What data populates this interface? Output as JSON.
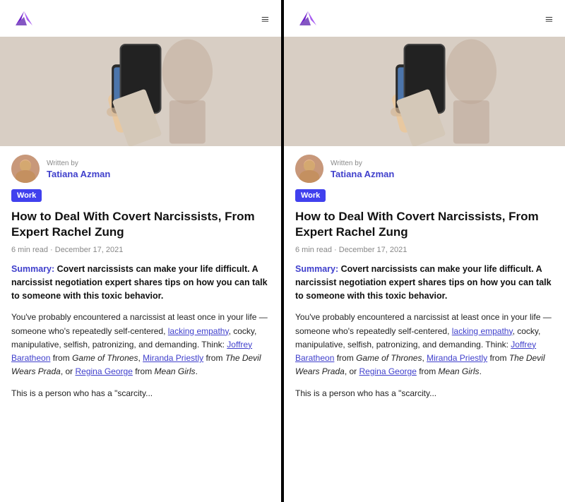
{
  "panels": [
    {
      "id": "left",
      "nav": {
        "logo_alt": "Logo",
        "menu_label": "≡"
      },
      "author": {
        "written_by": "Written by",
        "name": "Tatiana Azman"
      },
      "tag": "Work",
      "title": "How to Deal With Covert Narcissists, From Expert Rachel Zung",
      "meta": "6 min read  ·  December 17, 2021",
      "summary_label": "Summary:",
      "summary_text": " Covert narcissists can make your life difficult. A narcissist negotiation expert shares tips on how you can talk to someone with this toxic behavior.",
      "body1": "You've probably encountered a narcissist at least once in your life — someone who's repeatedly self-centered, ",
      "link1": "lacking empathy",
      "body2": ", cocky, manipulative, selfish, patronizing, and demanding. Think: ",
      "link2": "Joffrey Baratheon",
      "body3": " from ",
      "italic1": "Game of Thrones",
      "body4": ", ",
      "link3": "Miranda Priestly",
      "body5": " from ",
      "italic2": "The Devil Wears Prada",
      "body6": ", or ",
      "link4": "Regina George",
      "body7": " from ",
      "italic3": "Mean Girls",
      "body8": ".",
      "teaser": "This is a person who has a \"scarcity..."
    },
    {
      "id": "right",
      "nav": {
        "logo_alt": "Logo",
        "menu_label": "≡"
      },
      "author": {
        "written_by": "Written by",
        "name": "Tatiana Azman"
      },
      "tag": "Work",
      "title": "How to Deal With Covert Narcissists, From Expert Rachel Zung",
      "meta": "6 min read  ·  December 17, 2021",
      "summary_label": "Summary:",
      "summary_text": " Covert narcissists can make your life difficult. A narcissist negotiation expert shares tips on how you can talk to someone with this toxic behavior.",
      "body1": "You've probably encountered a narcissist at least once in your life — someone who's repeatedly self-centered, ",
      "link1": "lacking empathy",
      "body2": ", cocky, manipulative, selfish, patronizing, and demanding. Think: ",
      "link2": "Joffrey Baratheon",
      "body3": " from ",
      "italic1": "Game of Thrones",
      "body4": ", ",
      "link3": "Miranda Priestly",
      "body5": " from ",
      "italic2": "The Devil Wears Prada",
      "body6": ", or ",
      "link4": "Regina George",
      "body7": " from ",
      "italic3": "Mean Girls",
      "body8": ".",
      "teaser": "This is a person who has a \"scarcity..."
    }
  ],
  "colors": {
    "accent": "#4040ee",
    "link": "#4040cc",
    "tag_bg": "#4040ee",
    "tag_text": "#ffffff"
  }
}
